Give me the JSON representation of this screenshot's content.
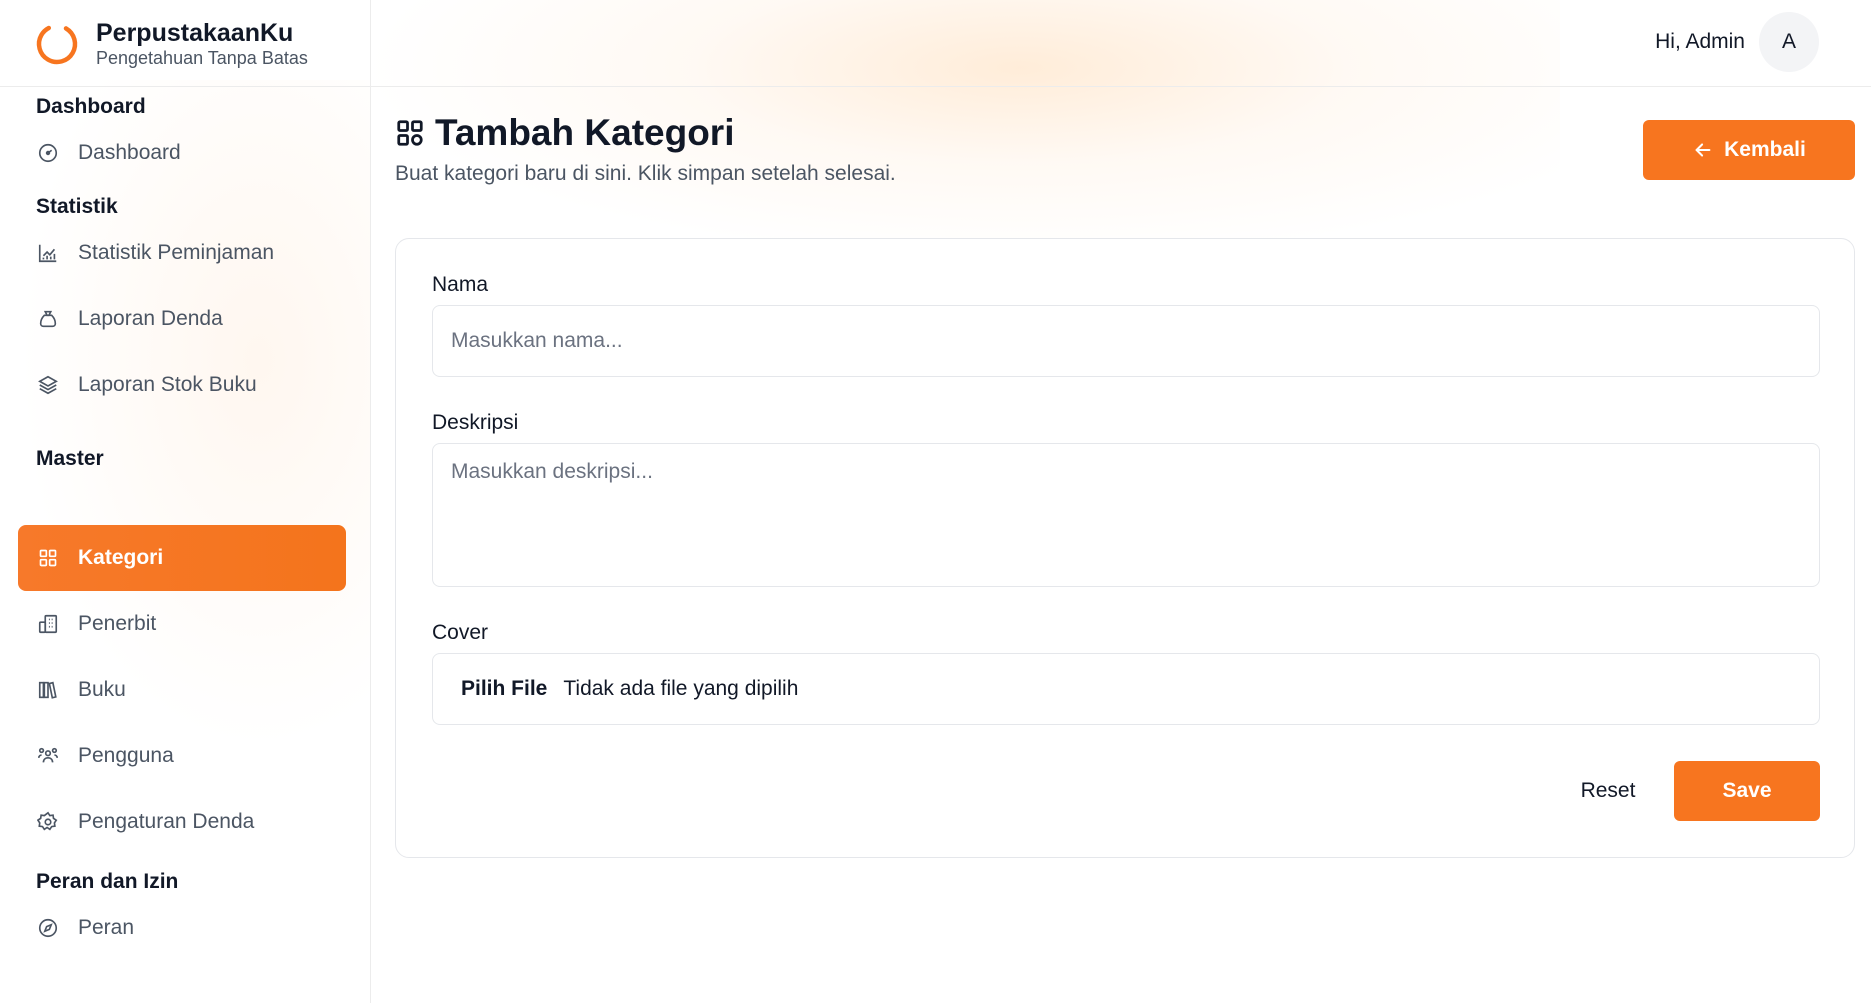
{
  "brand": {
    "name": "PerpustakaanKu",
    "tagline": "Pengetahuan Tanpa Batas",
    "logo_icon": "ring-logo-icon",
    "accent_color": "#f7751f"
  },
  "header": {
    "greeting": "Hi, Admin",
    "avatar_initial": "A"
  },
  "sidebar": {
    "sections": [
      {
        "title": "Dashboard",
        "items": [
          {
            "label": "Dashboard",
            "icon": "gauge-icon",
            "active": false
          }
        ]
      },
      {
        "title": "Statistik",
        "items": [
          {
            "label": "Statistik Peminjaman",
            "icon": "chart-icon",
            "active": false
          },
          {
            "label": "Laporan Denda",
            "icon": "money-bag-icon",
            "active": false
          },
          {
            "label": "Laporan Stok Buku",
            "icon": "layers-icon",
            "active": false
          }
        ]
      },
      {
        "title": "Master",
        "items": [
          {
            "label": "Kategori",
            "icon": "grid-icon",
            "active": true
          },
          {
            "label": "Penerbit",
            "icon": "building-icon",
            "active": false
          },
          {
            "label": "Buku",
            "icon": "books-icon",
            "active": false
          },
          {
            "label": "Pengguna",
            "icon": "users-icon",
            "active": false
          },
          {
            "label": "Pengaturan Denda",
            "icon": "settings-icon",
            "active": false
          }
        ]
      },
      {
        "title": "Peran dan Izin",
        "items": [
          {
            "label": "Peran",
            "icon": "compass-icon",
            "active": false
          }
        ]
      }
    ]
  },
  "page": {
    "title": "Tambah Kategori",
    "subtitle": "Buat kategori baru di sini. Klik simpan setelah selesai.",
    "back_label": "Kembali"
  },
  "form": {
    "name_label": "Nama",
    "name_placeholder": "Masukkan nama...",
    "description_label": "Deskripsi",
    "description_placeholder": "Masukkan deskripsi...",
    "cover_label": "Cover",
    "file_button": "Pilih File",
    "file_status": "Tidak ada file yang dipilih",
    "reset_label": "Reset",
    "save_label": "Save"
  }
}
